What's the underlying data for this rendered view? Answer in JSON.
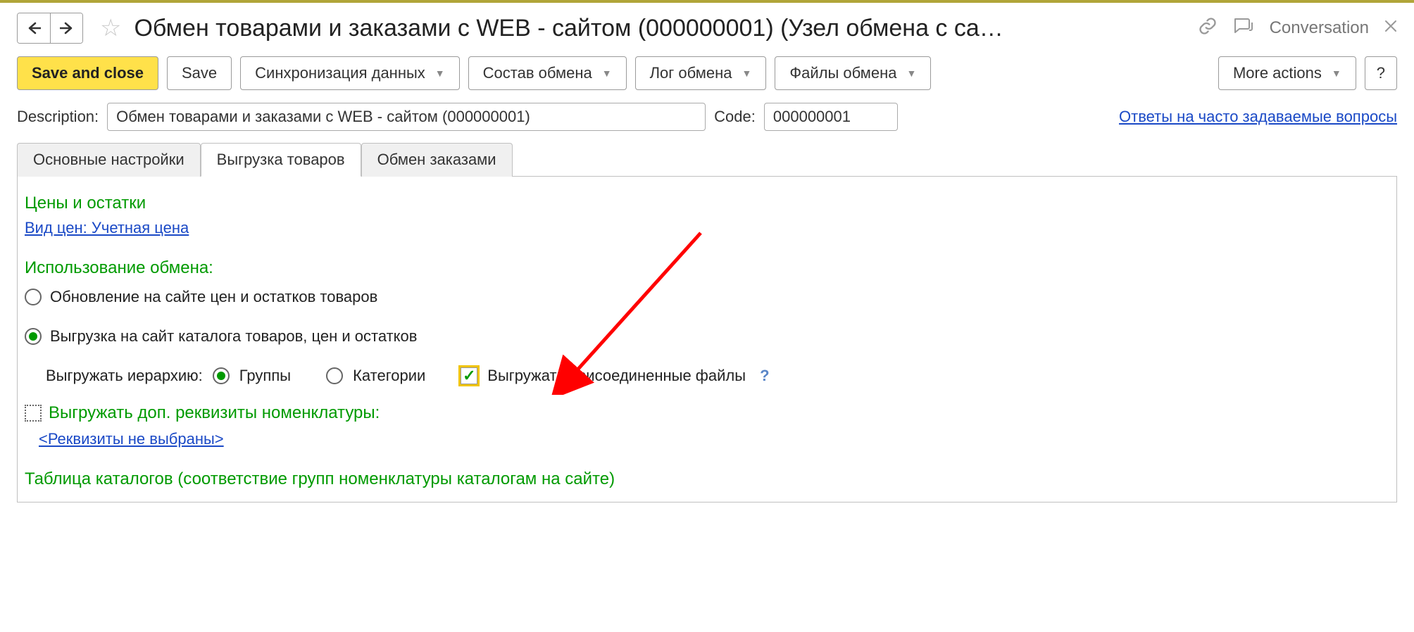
{
  "title": "Обмен товарами и заказами с WEB - сайтом (000000001) (Узел обмена с са…",
  "conversation_label": "Conversation",
  "toolbar": {
    "save_and_close": "Save and close",
    "save": "Save",
    "sync": "Синхронизация данных",
    "composition": "Состав обмена",
    "log": "Лог обмена",
    "files": "Файлы обмена",
    "more": "More actions",
    "help": "?"
  },
  "desc": {
    "label": "Description:",
    "value": "Обмен товарами и заказами с WEB - сайтом (000000001)",
    "code_label": "Code:",
    "code_value": "000000001",
    "faq": "Ответы на часто задаваемые вопросы"
  },
  "tabs": {
    "t0": "Основные настройки",
    "t1": "Выгрузка товаров",
    "t2": "Обмен заказами"
  },
  "content": {
    "prices_title": "Цены и остатки",
    "price_type_link": "Вид цен: Учетная цена",
    "usage_title": "Использование обмена:",
    "radio_update": "Обновление на сайте цен и остатков товаров",
    "radio_export": "Выгрузка на сайт каталога товаров, цен и остатков",
    "hierarchy_label": "Выгружать иерархию:",
    "hierarchy_groups": "Группы",
    "hierarchy_categories": "Категории",
    "export_attached": "Выгружать присоединенные файлы",
    "attached_help": "?",
    "export_extra": "Выгружать доп. реквизиты номенклатуры:",
    "extra_link": "<Реквизиты не выбраны>",
    "catalogs_title": "Таблица каталогов (соответствие групп номенклатуры каталогам на сайте)"
  }
}
